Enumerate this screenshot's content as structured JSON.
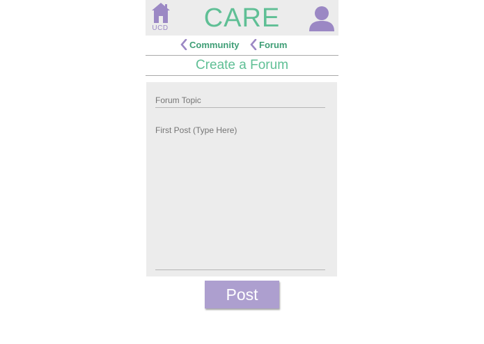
{
  "header": {
    "title": "CARE",
    "home_label": "UCD",
    "home_icon": "home-icon",
    "profile_icon": "user-icon"
  },
  "breadcrumbs": [
    {
      "label": "Community",
      "icon": "chevron-left-icon"
    },
    {
      "label": "Forum",
      "icon": "chevron-left-icon"
    }
  ],
  "page": {
    "title": "Create a Forum"
  },
  "form": {
    "topic_placeholder": "Forum Topic",
    "topic_value": "",
    "post_placeholder": "First Post (Type Here)",
    "post_value": ""
  },
  "actions": {
    "post_label": "Post"
  },
  "colors": {
    "accent_green": "#5fbf95",
    "accent_purple": "#9b88c4",
    "button_purple": "#ad9fcf",
    "panel_gray": "#ececec"
  }
}
